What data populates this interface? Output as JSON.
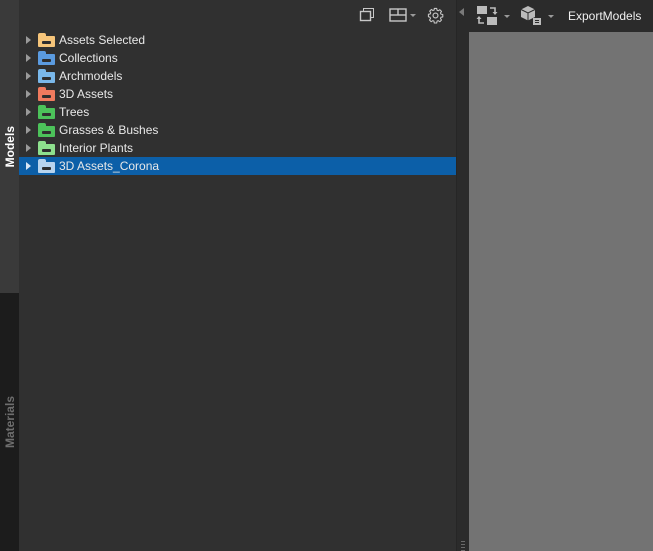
{
  "sidebar_tabs": {
    "models": "Models",
    "materials": "Materials"
  },
  "toolbar": {
    "icons": [
      "window-restore-icon",
      "layout-icon",
      "chevron-down-icon",
      "gear-icon"
    ]
  },
  "tree": {
    "items": [
      {
        "label": "Assets Selected",
        "color": "#f6c57a",
        "selected": false
      },
      {
        "label": "Collections",
        "color": "#5b9be0",
        "selected": false
      },
      {
        "label": "Archmodels",
        "color": "#7ab8ea",
        "selected": false
      },
      {
        "label": "3D Assets",
        "color": "#f07a5e",
        "selected": false
      },
      {
        "label": "Trees",
        "color": "#4cc25a",
        "selected": false
      },
      {
        "label": "Grasses & Bushes",
        "color": "#4cc25a",
        "selected": false
      },
      {
        "label": "Interior Plants",
        "color": "#8ee08e",
        "selected": false
      },
      {
        "label": "3D Assets_Corona",
        "color": "#b8d4ee",
        "selected": true
      }
    ]
  },
  "right_toolbar": {
    "export_label": "ExportModels",
    "icons": [
      "sync-icon",
      "model-box-icon"
    ]
  },
  "colors": {
    "selection": "#0c5fa8",
    "viewport": "#737373",
    "panel": "#303030"
  }
}
